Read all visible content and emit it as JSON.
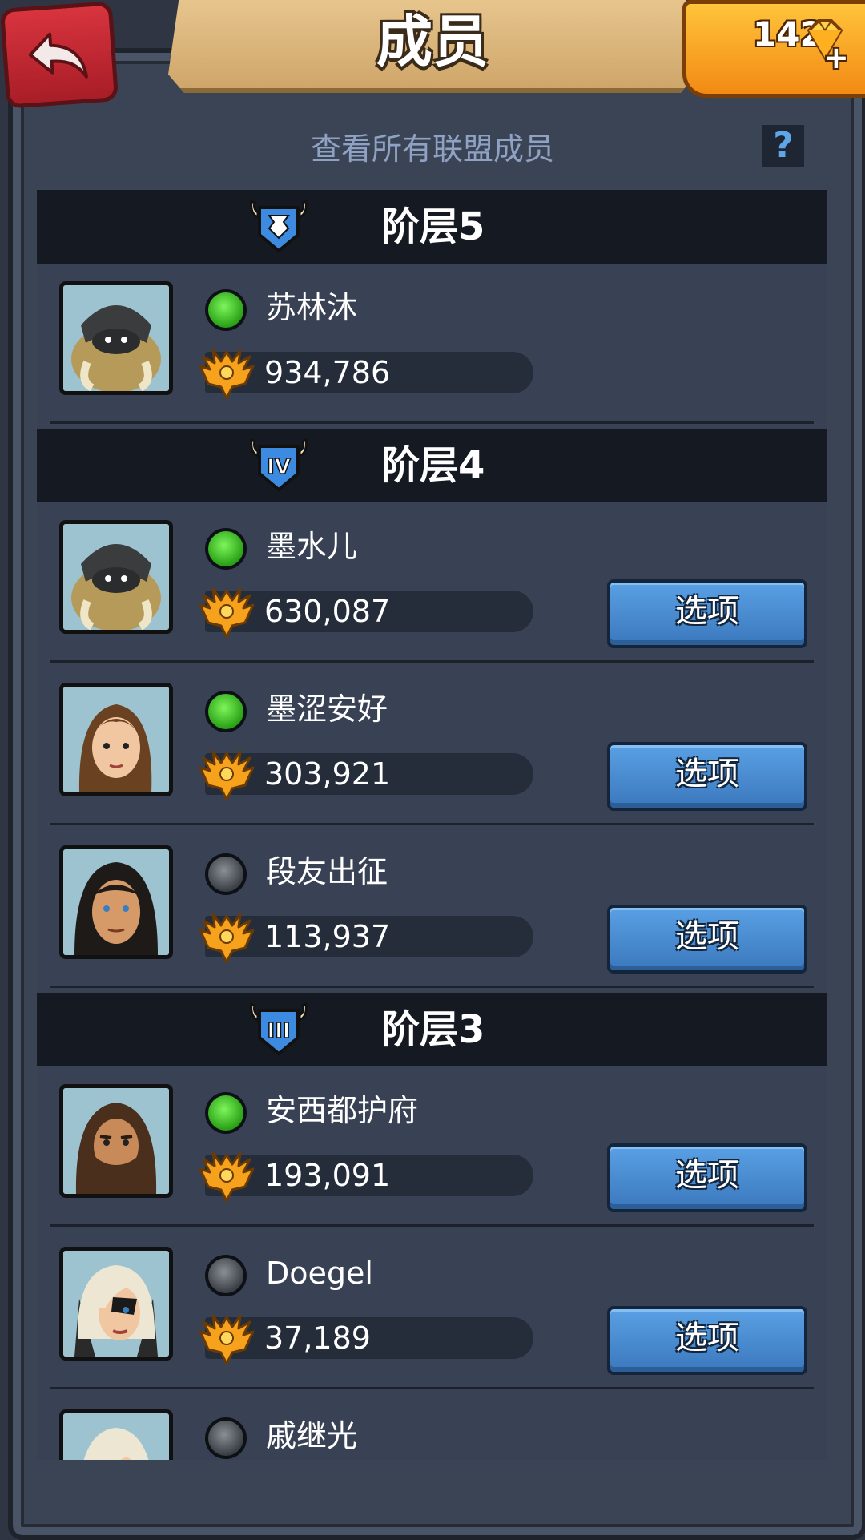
{
  "header": {
    "title": "成员",
    "gems": "142",
    "gem_plus": "+"
  },
  "subtitle": "查看所有联盟成员",
  "help": "?",
  "tiers": [
    {
      "label": "阶层5",
      "badge": "tier-5"
    },
    {
      "label": "阶层4",
      "badge": "IV"
    },
    {
      "label": "阶层3",
      "badge": "III"
    }
  ],
  "members": [
    {
      "name": "苏林沐",
      "score": "934,786",
      "online": true,
      "avatar": "beast"
    },
    {
      "name": "墨水儿",
      "score": "630,087",
      "online": true,
      "avatar": "beast",
      "option": "选项"
    },
    {
      "name": "墨涩安好",
      "score": "303,921",
      "online": true,
      "avatar": "woman-brown-hair",
      "option": "选项"
    },
    {
      "name": "段友出征",
      "score": "113,937",
      "online": false,
      "avatar": "man-long-hair",
      "option": "选项"
    },
    {
      "name": "安西都护府",
      "score": "193,091",
      "online": true,
      "avatar": "bearded-warrior",
      "option": "选项"
    },
    {
      "name": "Doegel",
      "score": "37,189",
      "online": false,
      "avatar": "white-hair-woman",
      "option": "选项"
    },
    {
      "name": "戚继光",
      "score": "",
      "online": false,
      "avatar": "white-hair-woman"
    }
  ],
  "colors": {
    "online": "#3fc427",
    "offline": "#5a5e66",
    "option_button": "#4a8ad0",
    "header_banner": "#dcb57a",
    "gem_box": "#f7a420"
  }
}
